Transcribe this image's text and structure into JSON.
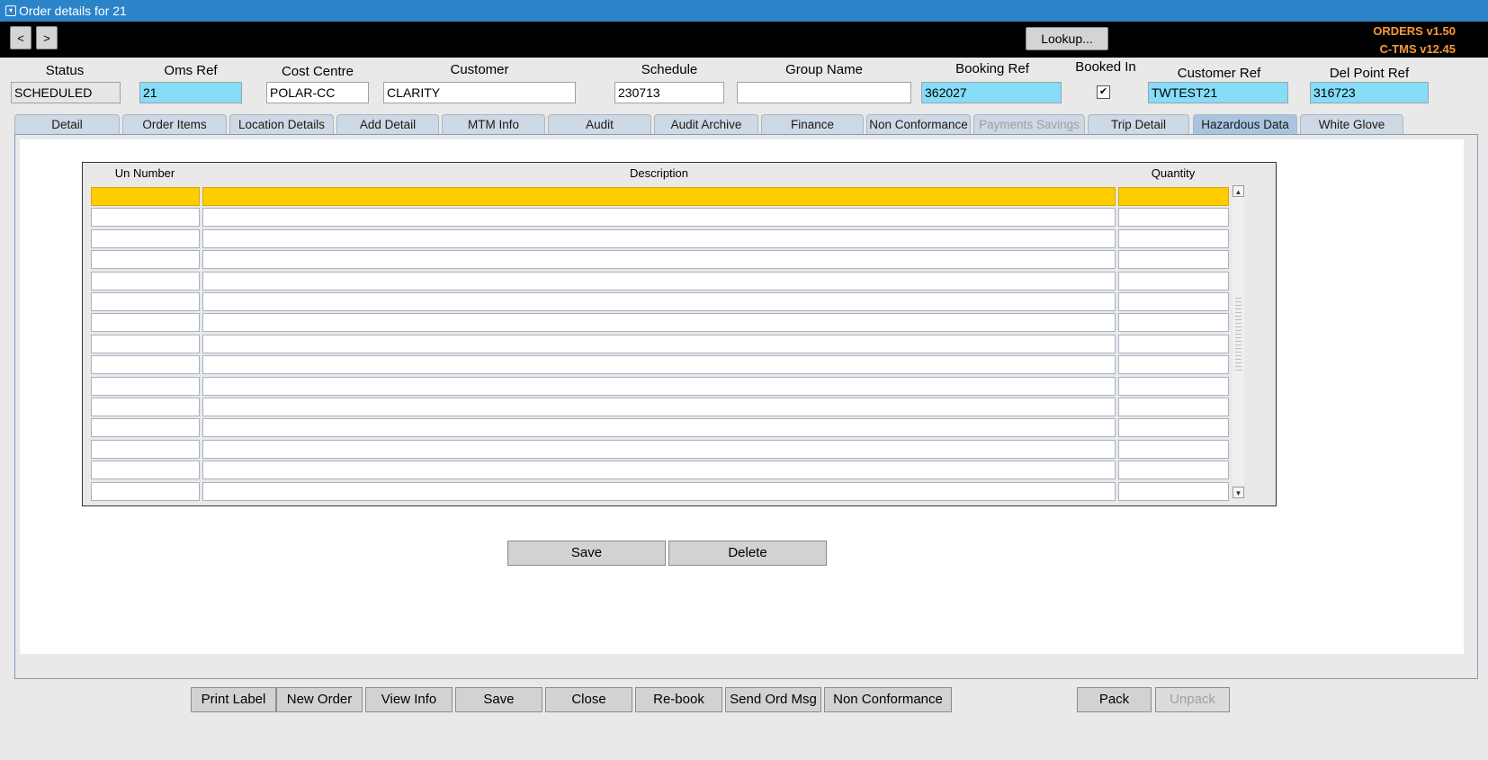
{
  "window": {
    "title": "Order details for 21"
  },
  "toolbar": {
    "prev_label": "<",
    "next_label": ">",
    "lookup_label": "Lookup...",
    "version_orders": "ORDERS v1.50",
    "version_ctms": "C-TMS v12.45"
  },
  "header": {
    "status": {
      "label": "Status",
      "value": "SCHEDULED"
    },
    "oms_ref": {
      "label": "Oms Ref",
      "value": "21"
    },
    "cost_centre": {
      "label": "Cost Centre",
      "value": "POLAR-CC"
    },
    "customer": {
      "label": "Customer",
      "value": "CLARITY"
    },
    "schedule": {
      "label": "Schedule",
      "value": "230713"
    },
    "group_name": {
      "label": "Group Name",
      "value": ""
    },
    "booking_ref": {
      "label": "Booking Ref",
      "value": "362027"
    },
    "booked_in": {
      "label": "Booked In",
      "checked": true,
      "mark": "✔"
    },
    "customer_ref": {
      "label": "Customer Ref",
      "value": "TWTEST21"
    },
    "del_point_ref": {
      "label": "Del Point Ref",
      "value": "316723"
    }
  },
  "tabs": [
    {
      "label": "Detail",
      "active": false,
      "disabled": false
    },
    {
      "label": "Order Items",
      "active": false,
      "disabled": false
    },
    {
      "label": "Location Details",
      "active": false,
      "disabled": false
    },
    {
      "label": "Add Detail",
      "active": false,
      "disabled": false
    },
    {
      "label": "MTM Info",
      "active": false,
      "disabled": false
    },
    {
      "label": "Audit",
      "active": false,
      "disabled": false
    },
    {
      "label": "Audit Archive",
      "active": false,
      "disabled": false
    },
    {
      "label": "Finance",
      "active": false,
      "disabled": false
    },
    {
      "label": "Non Conformance",
      "active": false,
      "disabled": false
    },
    {
      "label": "Payments  Savings",
      "active": false,
      "disabled": true
    },
    {
      "label": "Trip Detail",
      "active": false,
      "disabled": false
    },
    {
      "label": "Hazardous Data",
      "active": true,
      "disabled": false
    },
    {
      "label": "White Glove",
      "active": false,
      "disabled": false
    }
  ],
  "hazardous": {
    "columns": {
      "un_number": "Un Number",
      "description": "Description",
      "quantity": "Quantity"
    },
    "rows": [
      {
        "un_number": "",
        "description": "",
        "quantity": ""
      },
      {
        "un_number": "",
        "description": "",
        "quantity": ""
      },
      {
        "un_number": "",
        "description": "",
        "quantity": ""
      },
      {
        "un_number": "",
        "description": "",
        "quantity": ""
      },
      {
        "un_number": "",
        "description": "",
        "quantity": ""
      },
      {
        "un_number": "",
        "description": "",
        "quantity": ""
      },
      {
        "un_number": "",
        "description": "",
        "quantity": ""
      },
      {
        "un_number": "",
        "description": "",
        "quantity": ""
      },
      {
        "un_number": "",
        "description": "",
        "quantity": ""
      },
      {
        "un_number": "",
        "description": "",
        "quantity": ""
      },
      {
        "un_number": "",
        "description": "",
        "quantity": ""
      },
      {
        "un_number": "",
        "description": "",
        "quantity": ""
      },
      {
        "un_number": "",
        "description": "",
        "quantity": ""
      },
      {
        "un_number": "",
        "description": "",
        "quantity": ""
      },
      {
        "un_number": "",
        "description": "",
        "quantity": ""
      }
    ],
    "save_label": "Save",
    "delete_label": "Delete"
  },
  "footer": {
    "buttons": [
      {
        "label": "Print Label",
        "disabled": false
      },
      {
        "label": "New Order",
        "disabled": false
      },
      {
        "label": "View Info",
        "disabled": false
      },
      {
        "label": "Save",
        "disabled": false
      },
      {
        "label": "Close",
        "disabled": false
      },
      {
        "label": "Re-book",
        "disabled": false
      },
      {
        "label": "Send Ord Msg",
        "disabled": false
      },
      {
        "label": "Non Conformance",
        "disabled": false
      }
    ],
    "pack_label": "Pack",
    "unpack_label": "Unpack"
  },
  "colors": {
    "titlebar": "#2c84c8",
    "version_text": "#f59a3a",
    "highlight_field": "#87dcf7",
    "selected_row": "#ffcc00",
    "active_tab": "#a9c4de"
  }
}
